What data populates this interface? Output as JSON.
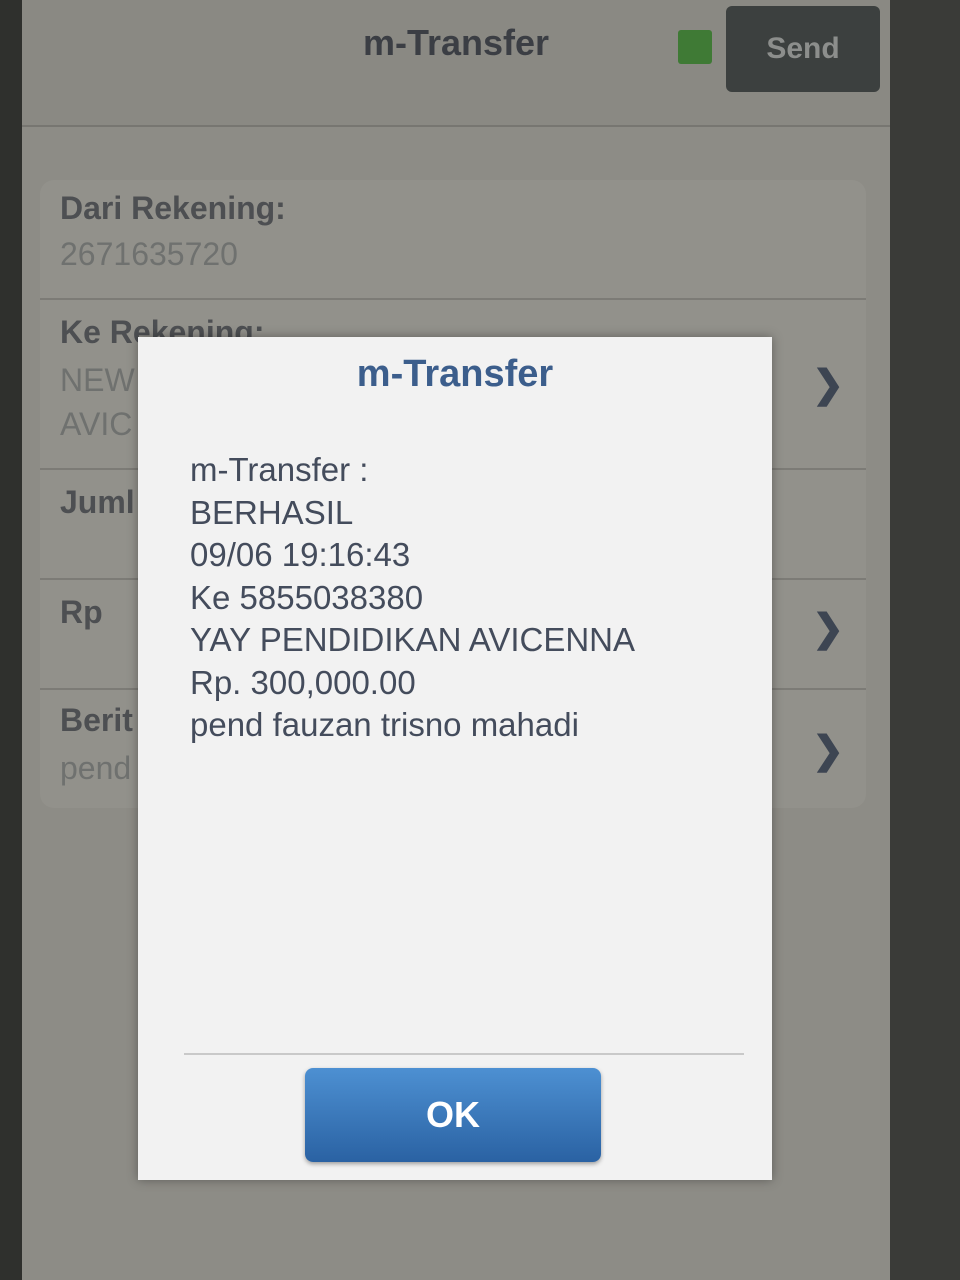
{
  "header": {
    "title": "m-Transfer",
    "send_label": "Send",
    "status_color": "#3f7a35"
  },
  "form": {
    "from_account_label": "Dari Rekening:",
    "from_account_value": "2671635720",
    "to_account_label": "Ke Rekening:",
    "to_account_value_line1": "NEW",
    "to_account_value_line2": "AVIC",
    "amount_label": "Juml",
    "currency_label": "Rp",
    "message_label": "Berit",
    "message_value": "pend"
  },
  "dialog": {
    "title": "m-Transfer",
    "lines": [
      "m-Transfer :",
      "BERHASIL",
      "09/06 19:16:43",
      "Ke 5855038380",
      "YAY PENDIDIKAN AVICENNA",
      "Rp. 300,000.00",
      "pend fauzan trisno mahadi"
    ],
    "ok_label": "OK"
  },
  "icons": {
    "chevron": "chevron-right-icon"
  },
  "colors": {
    "dialog_title": "#3c5e8c",
    "ok_button": "#2f6fb4"
  }
}
